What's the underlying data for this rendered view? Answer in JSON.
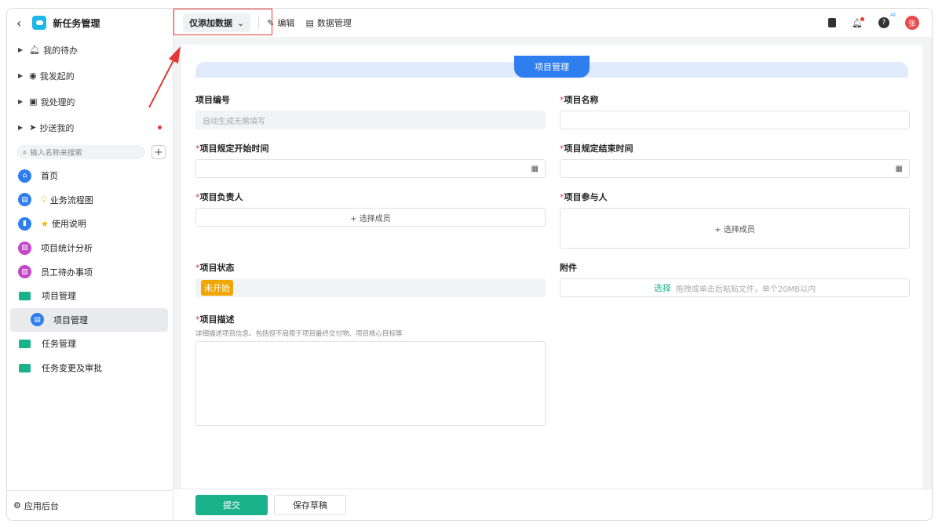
{
  "app": {
    "title": "新任务管理"
  },
  "sidebar": {
    "groups": [
      {
        "label": "我的待办",
        "icon": "bell-icon"
      },
      {
        "label": "我发起的",
        "icon": "play-icon"
      },
      {
        "label": "我处理的",
        "icon": "check-box-icon"
      },
      {
        "label": "抄送我的",
        "icon": "send-icon"
      }
    ],
    "search_placeholder": "输入名称来搜索",
    "items": [
      {
        "label": "首页"
      },
      {
        "label": "业务流程图"
      },
      {
        "label": "使用说明"
      },
      {
        "label": "项目统计分析"
      },
      {
        "label": "员工待办事项"
      },
      {
        "label": "项目管理"
      },
      {
        "label": "项目管理"
      },
      {
        "label": "任务管理"
      },
      {
        "label": "任务变更及审批"
      }
    ],
    "footer": "应用后台"
  },
  "toolbar": {
    "mode": "仅添加数据",
    "edit": "编辑",
    "data_manage": "数据管理",
    "ai_badge": "AI",
    "avatar": "张"
  },
  "form": {
    "section_title": "项目管理",
    "fields": {
      "code": {
        "label": "项目编号",
        "placeholder": "自动生成无需填写"
      },
      "name": {
        "label": "项目名称"
      },
      "start": {
        "label": "项目规定开始时间"
      },
      "end": {
        "label": "项目规定结束时间"
      },
      "owner": {
        "label": "项目负责人",
        "action": "+ 选择成员"
      },
      "members": {
        "label": "项目参与人",
        "action": "+ 选择成员"
      },
      "status": {
        "label": "项目状态",
        "value": "未开始"
      },
      "attach": {
        "label": "附件",
        "action": "选择",
        "hint": "拖拽或单击后粘贴文件，单个20MB以内"
      },
      "desc": {
        "label": "项目描述",
        "hint": "详细描述项目信息。包括但不局限于项目最终交付物、项目核心目标等"
      }
    },
    "required_mark": "*",
    "submit": "提交",
    "save_draft": "保存草稿"
  },
  "colors": {
    "accent": "#19b28a",
    "primary": "#2f7ef0",
    "status": "#f0a500"
  }
}
